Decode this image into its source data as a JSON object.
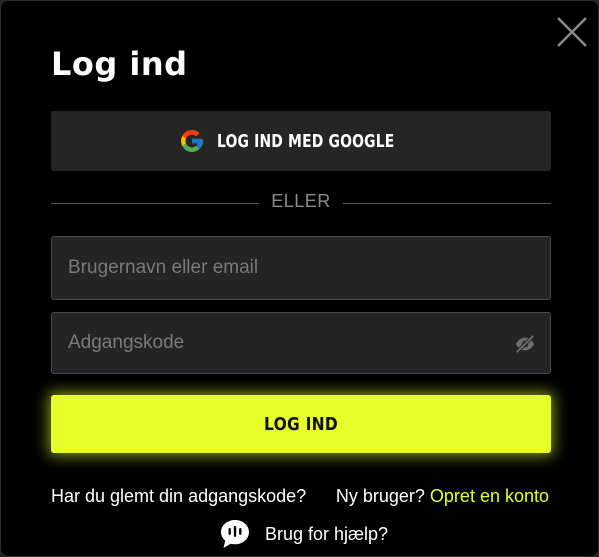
{
  "modal": {
    "title": "Log ind",
    "google_button": {
      "label": "LOG IND MED GOOGLE",
      "icon": "google-icon"
    },
    "divider_text": "ELLER",
    "username_field": {
      "placeholder": "Brugernavn eller email",
      "value": ""
    },
    "password_field": {
      "placeholder": "Adgangskode",
      "value": "",
      "toggle_icon": "eye-slash-icon"
    },
    "login_button": {
      "label": "LOG IND"
    },
    "forgot_link": "Har du glemt din adgangskode?",
    "signup": {
      "question": "Ny bruger?",
      "link": "Opret en konto"
    },
    "help": {
      "label": "Brug for hjælp?",
      "icon": "chat-bubble-icon"
    },
    "close_icon": "close-icon"
  },
  "colors": {
    "background": "#000000",
    "accent": "#e6ff29",
    "field_bg": "#242424",
    "google_btn_bg": "#252525",
    "muted_text": "#7a7a7a"
  }
}
